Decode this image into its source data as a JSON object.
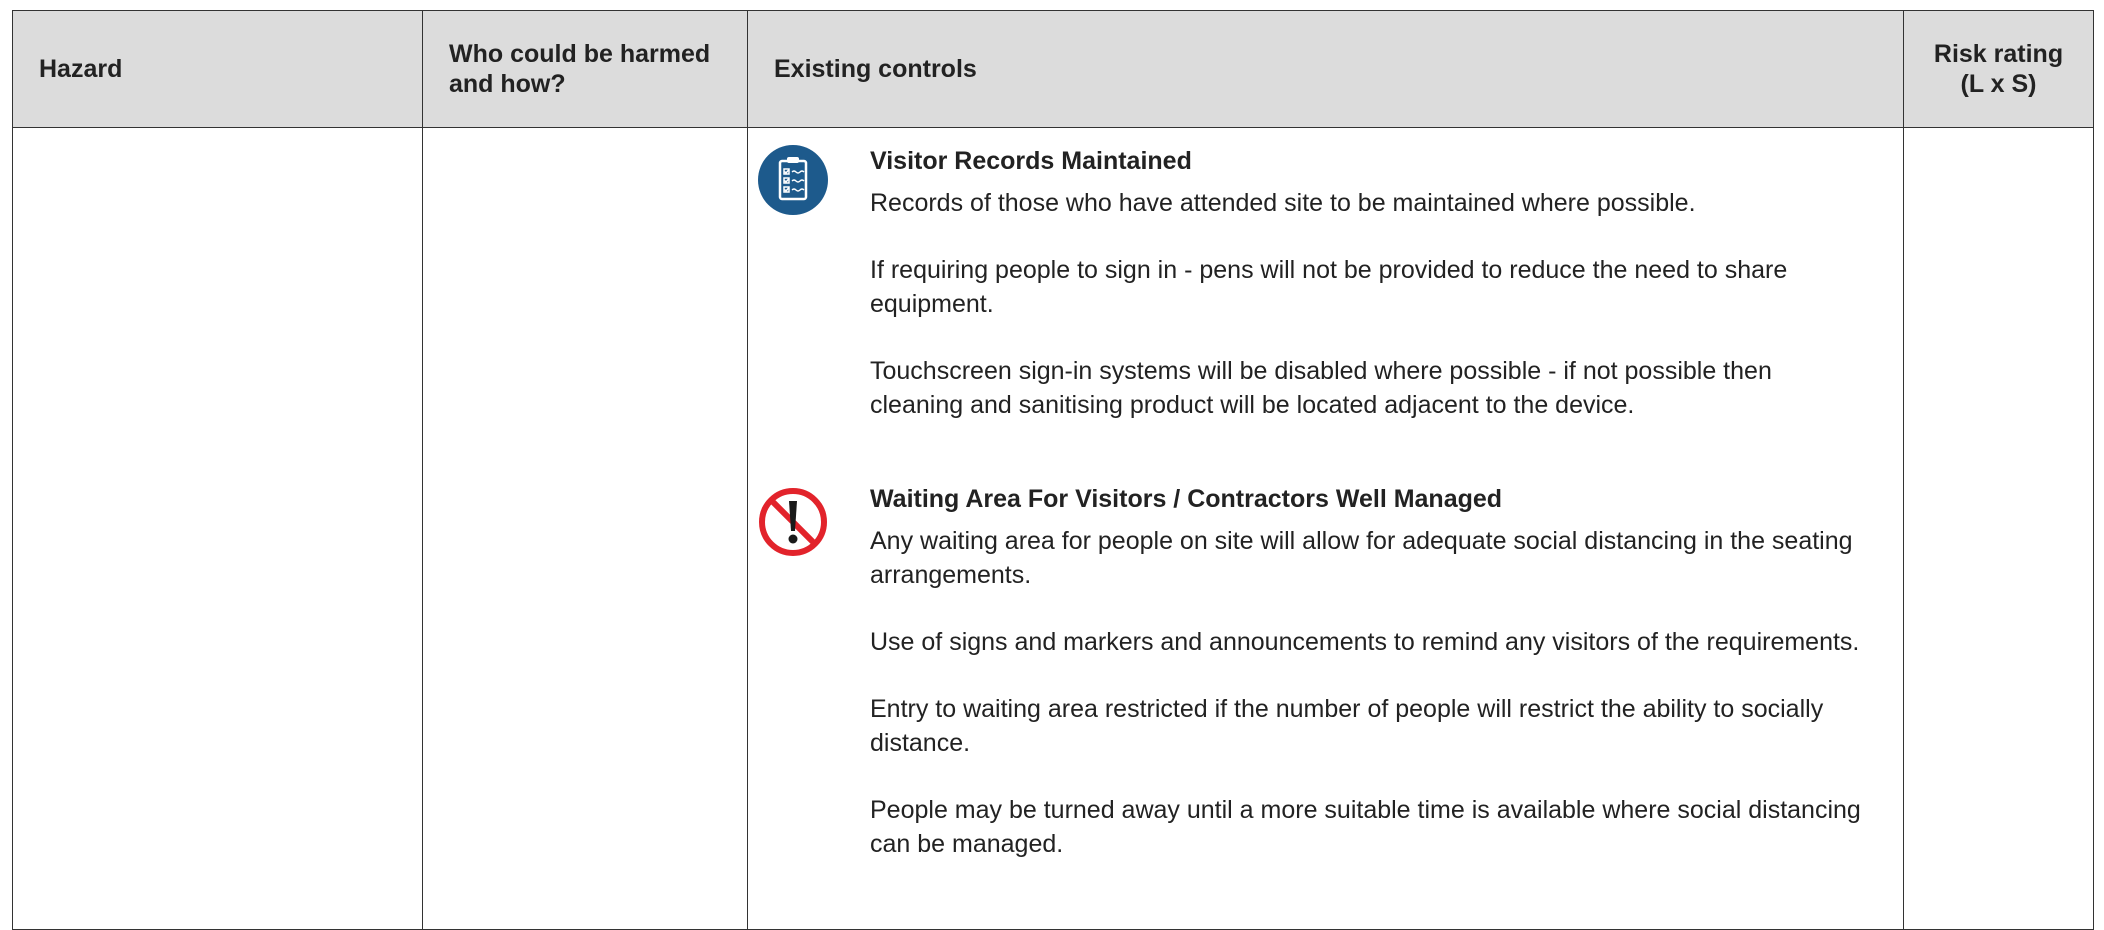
{
  "table": {
    "headers": {
      "hazard": "Hazard",
      "who_harmed": "Who could be harmed and how?",
      "existing_controls": "Existing controls",
      "risk_rating": "Risk rating (L x S)"
    },
    "rows": [
      {
        "hazard": "",
        "who_harmed": "",
        "controls": [
          {
            "icon": "clipboard-checklist-icon",
            "title": "Visitor Records Maintained",
            "paragraphs": [
              "Records of those who have attended site to be maintained where possible.",
              "If requiring people to sign in - pens will not be provided to reduce the need to share equipment.",
              "Touchscreen sign-in systems will be disabled where possible - if not possible then cleaning and sanitising product will be located adjacent to the device."
            ]
          },
          {
            "icon": "prohibition-exclamation-icon",
            "title": "Waiting Area For Visitors / Contractors Well Managed",
            "paragraphs": [
              "Any waiting area for people on site will allow for adequate social distancing in the seating arrangements.",
              "Use of signs and markers and announcements to remind any visitors of the requirements.",
              "Entry to waiting area restricted if the number of people will restrict the ability to socially distance.",
              "People may be turned away until a more suitable time is available where social distancing can be managed."
            ]
          }
        ],
        "risk_rating": ""
      }
    ]
  },
  "colors": {
    "header_bg": "#dcdcdc",
    "icon_blue": "#1d5a8c",
    "prohibition_red": "#e2232b",
    "border": "#333333"
  }
}
